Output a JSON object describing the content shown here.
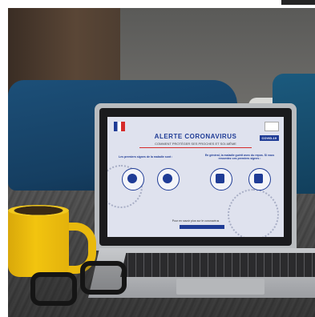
{
  "laptop_screen": {
    "title": "ALERTE CORONAVIRUS",
    "subtitle": "COMMENT PROTÉGER SES PROCHES ET SOI-MÊME",
    "badge": "COVID-19",
    "left_heading": "Les premiers signes de la maladie sont :",
    "right_heading": "En général, la maladie guérit avec du repos. Si vous ressentez ces premiers signes :",
    "footer": "Pour en savoir plus sur le coronavirus",
    "colors": {
      "primary": "#1f3c96",
      "accent": "#d62b2b"
    }
  },
  "objects": [
    "yellow-mug",
    "eyeglasses",
    "laptop",
    "blue-pillows",
    "bed"
  ]
}
